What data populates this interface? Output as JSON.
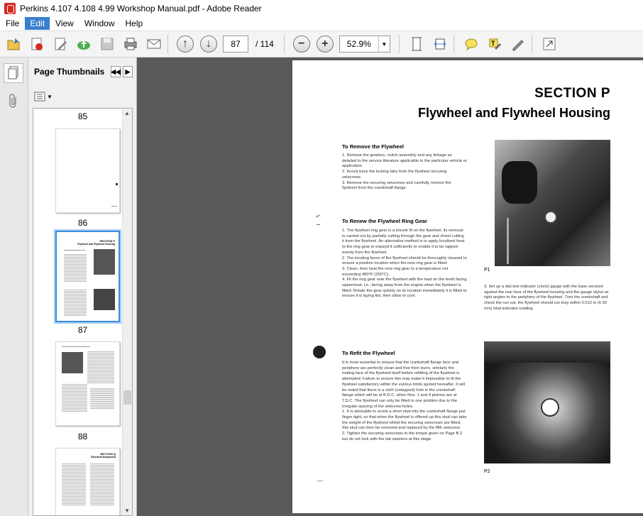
{
  "window": {
    "title": "Perkins 4.107 4.108 4.99 Workshop Manual.pdf - Adobe Reader"
  },
  "menu": [
    "File",
    "Edit",
    "View",
    "Window",
    "Help"
  ],
  "toolbar": {
    "page_current": "87",
    "page_total": "/ 114",
    "zoom": "52.9%",
    "zoom_out": "−",
    "zoom_in": "+"
  },
  "sidebar": {
    "title": "Page Thumbnails",
    "thumbnails": [
      {
        "label": "85"
      },
      {
        "label": "86"
      },
      {
        "label": "87"
      },
      {
        "label": "88"
      }
    ]
  },
  "page": {
    "section": "SECTION P",
    "subtitle": "Flywheel and Flywheel Housing",
    "h1": "To Remove the Flywheel",
    "p1": [
      "1.  Remove the gearbox, clutch assembly and any linkage as detailed in the service literature applicable to the particular vehicle or application.",
      "2.  Knock back the locking tabs from the flywheel securing setscrews.",
      "3.  Remove the securing setscrews and carefully remove the flywheel from the crankshaft flange."
    ],
    "h2": "To Renew the Flywheel Ring Gear",
    "p2": [
      "1.  The flywheel ring gear is a shrunk fit on the flywheel, its removal is carried out by partially cutting through the gear and chisel cutting it from the flywheel. An alternative method is to apply localised heat to the ring gear to expand it sufficiently to enable it to be tapped evenly from the flywheel.",
      "2.  The locating faces of the flywheel should be thoroughly cleaned to ensure a positive location when the new ring gear is fitted.",
      "3.  Clean, then heat the new ring gear to a temperature not exceeding 480°F (250°C).",
      "4.  Fit the ring gear over the flywheel with the lead on the teeth facing uppermost, i.e., facing away from the engine when the flywheel is fitted. Rotate the gear quickly on its location immediately it is fitted to ensure it is laying flat, then allow to cool."
    ],
    "h3": "To Refit the Flywheel",
    "p3_intro": "It is most essential to ensure that the crankshaft flange face and periphery are perfectly clean and free from burrs, similarly the mating face of the flywheel itself before refitting of the flywheel is attempted. Failure to ensure this may make it impossible to fit the flywheel satisfactory within the various limits quoted hereafter. It will be noted that there is a sixth (untapped) hole in the crankshaft flange which will be at B.D.C. when Nos. 1 and 4 pistons are at T.D.C. The flywheel can only be fitted in one position due to the irregular spacing of the setscrew holes.",
    "p3": [
      "1.  It is advisable to screw a short stud into the crankshaft flange just finger tight, so that when the flywheel is offered up this stud can take the weight of the flywheel whilst the securing setscrews are fitted, this stud can then be removed and replaced by the fifth setscrew.",
      "2.  Tighten the securing setscrews to the torque given on Page B.2 but do not lock with the tab washers at this stage."
    ],
    "p4": "3.  Set up a dial test indicator (clock) gauge with the base secured against the rear face of the flywheel housing and the gauge stylus at right angles to the periphery of the flywheel. Turn the crankshaft and check the run out, the flywheel should run truly within 0.012 in (0.30 mm) total indicator reading",
    "cap1": "P1",
    "cap2": "P2"
  }
}
